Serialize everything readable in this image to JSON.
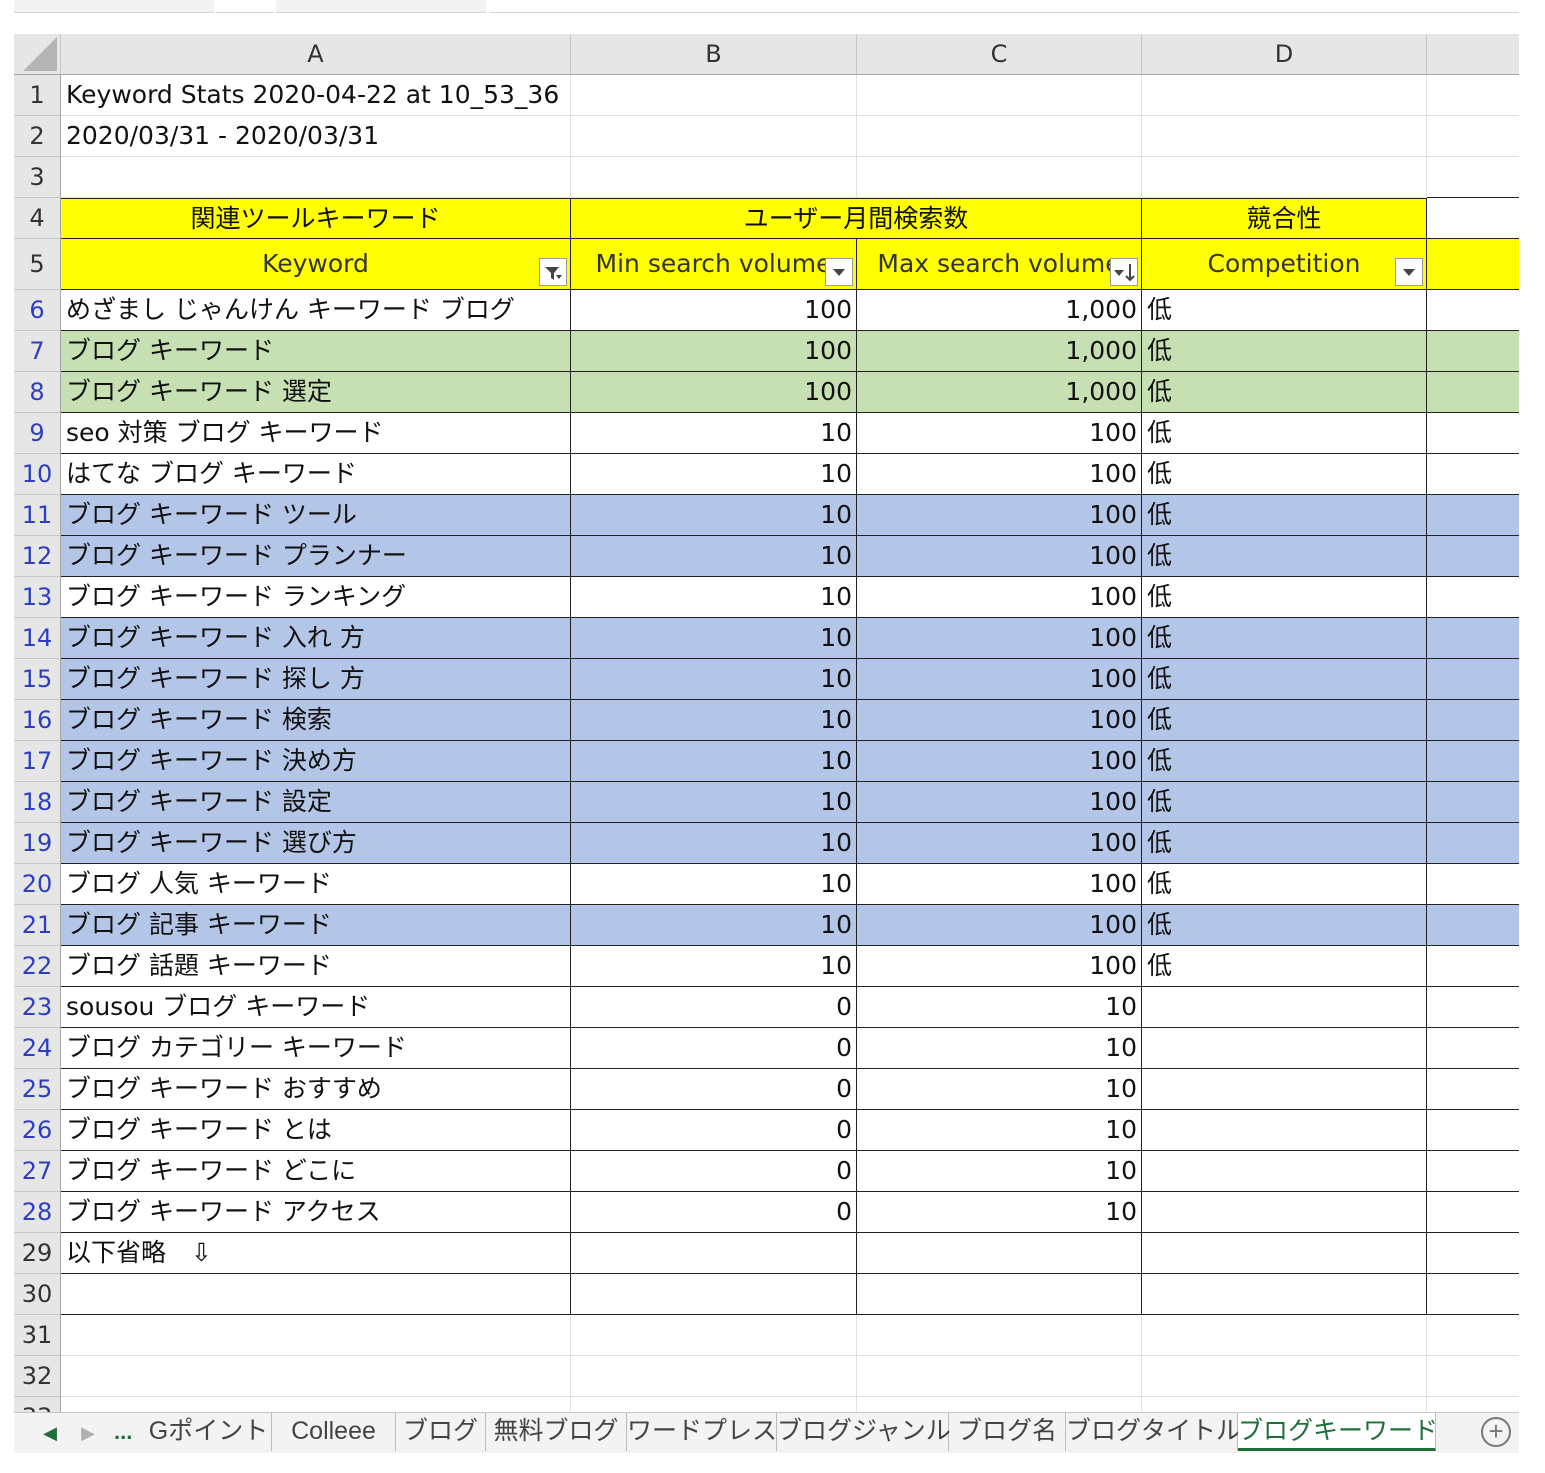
{
  "columns": [
    "A",
    "B",
    "C",
    "D"
  ],
  "title_row": "Keyword Stats 2020-04-22 at 10_53_36",
  "date_range": "2020/03/31 - 2020/03/31",
  "group_headers": {
    "keyword_group": "関連ツールキーワード",
    "volume_group": "ユーザー月間検索数",
    "competition_group": "競合性"
  },
  "table_headers": {
    "keyword": "Keyword",
    "min_volume": "Min search volume",
    "max_volume": "Max search volume",
    "competition": "Competition"
  },
  "rows": [
    {
      "row": "6",
      "keyword": "めざまし じゃんけん キーワード ブログ",
      "min": "100",
      "max": "1,000",
      "comp": "低",
      "fill": ""
    },
    {
      "row": "7",
      "keyword": "ブログ キーワード",
      "min": "100",
      "max": "1,000",
      "comp": "低",
      "fill": "green"
    },
    {
      "row": "8",
      "keyword": "ブログ キーワード 選定",
      "min": "100",
      "max": "1,000",
      "comp": "低",
      "fill": "green"
    },
    {
      "row": "9",
      "keyword": "seo 対策 ブログ キーワード",
      "min": "10",
      "max": "100",
      "comp": "低",
      "fill": ""
    },
    {
      "row": "10",
      "keyword": "はてな ブログ キーワード",
      "min": "10",
      "max": "100",
      "comp": "低",
      "fill": ""
    },
    {
      "row": "11",
      "keyword": "ブログ キーワード ツール",
      "min": "10",
      "max": "100",
      "comp": "低",
      "fill": "blue"
    },
    {
      "row": "12",
      "keyword": "ブログ キーワード プランナー",
      "min": "10",
      "max": "100",
      "comp": "低",
      "fill": "blue"
    },
    {
      "row": "13",
      "keyword": "ブログ キーワード ランキング",
      "min": "10",
      "max": "100",
      "comp": "低",
      "fill": ""
    },
    {
      "row": "14",
      "keyword": "ブログ キーワード 入れ 方",
      "min": "10",
      "max": "100",
      "comp": "低",
      "fill": "blue"
    },
    {
      "row": "15",
      "keyword": "ブログ キーワード 探し 方",
      "min": "10",
      "max": "100",
      "comp": "低",
      "fill": "blue"
    },
    {
      "row": "16",
      "keyword": "ブログ キーワード 検索",
      "min": "10",
      "max": "100",
      "comp": "低",
      "fill": "blue"
    },
    {
      "row": "17",
      "keyword": "ブログ キーワード 決め方",
      "min": "10",
      "max": "100",
      "comp": "低",
      "fill": "blue"
    },
    {
      "row": "18",
      "keyword": "ブログ キーワード 設定",
      "min": "10",
      "max": "100",
      "comp": "低",
      "fill": "blue"
    },
    {
      "row": "19",
      "keyword": "ブログ キーワード 選び方",
      "min": "10",
      "max": "100",
      "comp": "低",
      "fill": "blue"
    },
    {
      "row": "20",
      "keyword": "ブログ 人気 キーワード",
      "min": "10",
      "max": "100",
      "comp": "低",
      "fill": ""
    },
    {
      "row": "21",
      "keyword": "ブログ 記事 キーワード",
      "min": "10",
      "max": "100",
      "comp": "低",
      "fill": "blue"
    },
    {
      "row": "22",
      "keyword": "ブログ 話題 キーワード",
      "min": "10",
      "max": "100",
      "comp": "低",
      "fill": ""
    },
    {
      "row": "23",
      "keyword": "sousou ブログ キーワード",
      "min": "0",
      "max": "10",
      "comp": "",
      "fill": ""
    },
    {
      "row": "24",
      "keyword": "ブログ カテゴリー キーワード",
      "min": "0",
      "max": "10",
      "comp": "",
      "fill": ""
    },
    {
      "row": "25",
      "keyword": "ブログ キーワード おすすめ",
      "min": "0",
      "max": "10",
      "comp": "",
      "fill": ""
    },
    {
      "row": "26",
      "keyword": "ブログ キーワード とは",
      "min": "0",
      "max": "10",
      "comp": "",
      "fill": ""
    },
    {
      "row": "27",
      "keyword": "ブログ キーワード どこに",
      "min": "0",
      "max": "10",
      "comp": "",
      "fill": ""
    },
    {
      "row": "28",
      "keyword": "ブログ キーワード アクセス",
      "min": "0",
      "max": "10",
      "comp": "",
      "fill": ""
    },
    {
      "row": "29",
      "keyword": "以下省略　⇩",
      "min": "",
      "max": "",
      "comp": "",
      "fill": ""
    },
    {
      "row": "30",
      "keyword": "",
      "min": "",
      "max": "",
      "comp": "",
      "fill": ""
    }
  ],
  "trailing_rows": [
    "31",
    "32",
    "33"
  ],
  "colors": {
    "header_yellow": "#ffff00",
    "highlight_green": "#c6e0b4",
    "highlight_blue": "#b4c6e7",
    "filtered_row_number": "#2d3fbf",
    "active_tab": "#1e6f3a"
  },
  "tabbar": {
    "more": "...",
    "tabs": [
      "Gポイント",
      "Colleee",
      "ブログ",
      "無料ブログ",
      "ワードプレス",
      "ブログジャンル",
      "ブログ名",
      "ブログタイトル",
      "ブログキーワード"
    ],
    "active_tab": "ブログキーワード"
  }
}
